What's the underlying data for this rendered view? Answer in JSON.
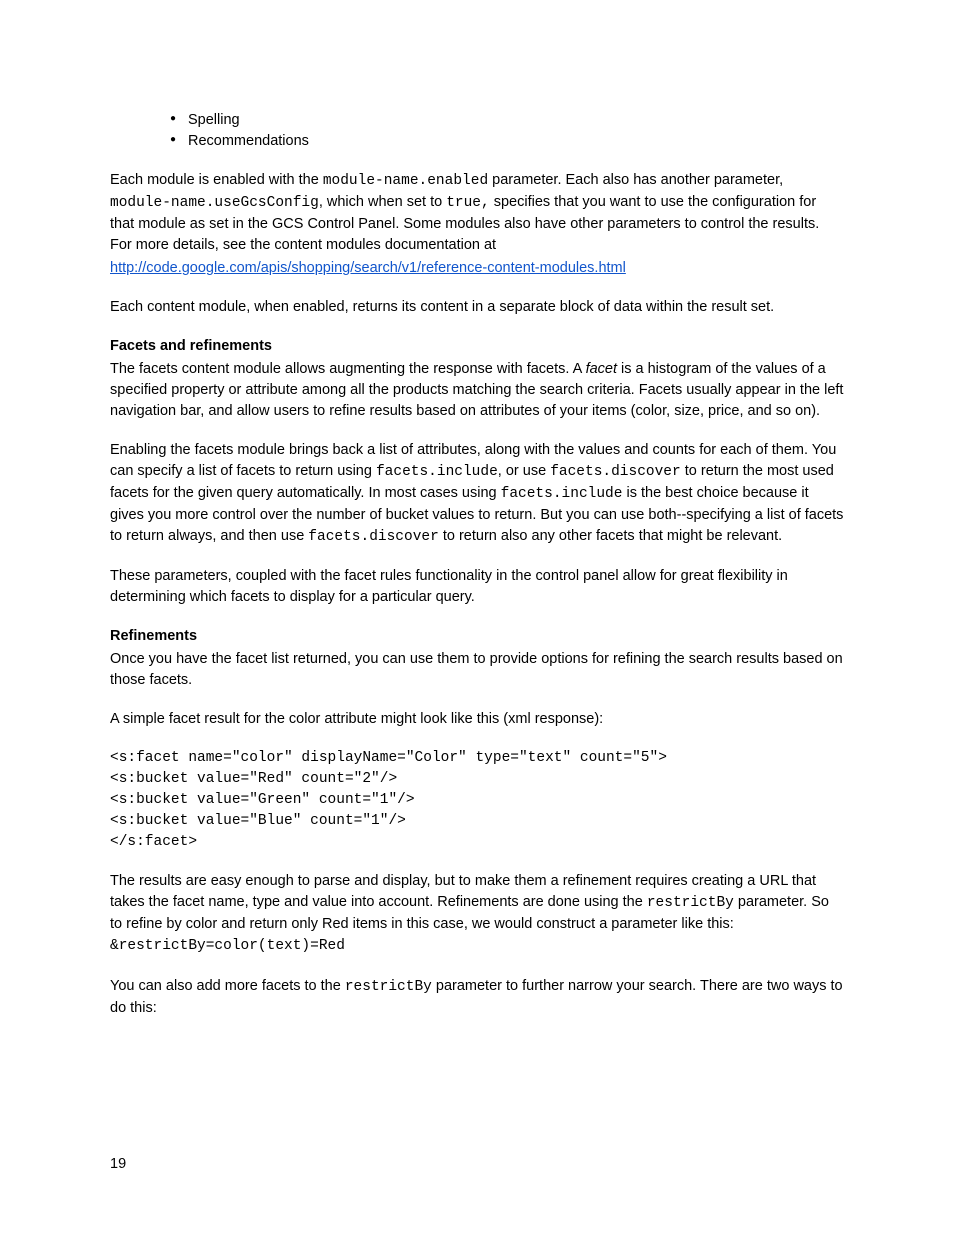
{
  "bullets": [
    "Spelling",
    "Recommendations"
  ],
  "para1": {
    "t1": "Each module is enabled with the ",
    "c1": "module-name.enabled",
    "t2": " parameter. Each also has another parameter, ",
    "c2": "module-name.useGcsConfig",
    "t3": ", which when set to ",
    "c3": "true,",
    "t4": " specifies that you want to use the configuration for that module as set in the GCS Control Panel. Some modules also have other parameters to control the results.  For more details, see the content modules documentation at"
  },
  "link1": "http://code.google.com/apis/shopping/search/v1/reference-content-modules.html",
  "para2": "Each content module, when enabled, returns its content in a separate block of data within the result set.",
  "h1": "Facets and refinements",
  "para3": {
    "t1": "The facets content module allows augmenting the response with facets. A ",
    "i1": "facet",
    "t2": " is a histogram of the values of a specified property or attribute among all the products matching the search criteria.  Facets usually appear in the left navigation bar, and allow users to refine results based on attributes of your items (color, size, price, and so on)."
  },
  "para4": {
    "t1": "Enabling the facets module brings back a list of attributes, along with the values and counts for each of them. You can specify a list of facets to return using ",
    "c1": "facets.include",
    "t2": ", or use ",
    "c2": "facets.discover",
    "t3": " to return the most used facets for the given query automatically. In most cases using ",
    "c3": "facets.include",
    "t4": " is the best choice because it gives you more control over the number of bucket values to return. But you can use both--specifying a list of facets to return always, and then use ",
    "c4": "facets.discover",
    "t5": " to return also any other facets that might be relevant."
  },
  "para5": "These parameters, coupled with the facet rules functionality in the control panel allow for great flexibility in determining which facets to display for a particular query.",
  "h2": "Refinements",
  "para6": "Once you have the facet list returned, you can use them to provide options for refining the search results based on those facets.",
  "para7": "A simple facet result for the color attribute might look like this (xml response):",
  "code1": "<s:facet name=\"color\" displayName=\"Color\" type=\"text\" count=\"5\">\n<s:bucket value=\"Red\" count=\"2\"/>\n<s:bucket value=\"Green\" count=\"1\"/>\n<s:bucket value=\"Blue\" count=\"1\"/>\n</s:facet>",
  "para8": {
    "t1": "The results are easy enough to parse and display, but to make them a refinement requires creating a URL that takes the facet name, type and value into account. Refinements are done using the ",
    "c1": "restrictBy",
    "t2": " parameter.  So to refine by color and return only Red items in this case, we would construct a parameter like this: ",
    "c2": "&restrictBy=color(text)=Red"
  },
  "para9": {
    "t1": "You can also add more facets to the ",
    "c1": "restrictBy",
    "t2": " parameter to further narrow your search.  There are two ways to do this:"
  },
  "pagenum": "19"
}
